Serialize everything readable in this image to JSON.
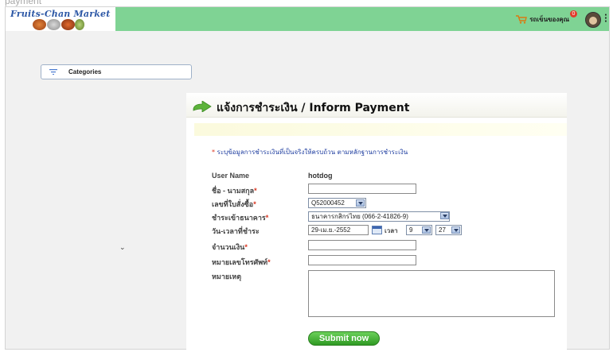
{
  "page": {
    "corner_text": "payment"
  },
  "header": {
    "logo_text": "Fruits-Chan Market",
    "cart_label": "รถเข็นของคุณ",
    "cart_count": "0",
    "colors": {
      "topbar": "#7fd394",
      "logo_text": "#2d58a6"
    }
  },
  "sidebar": {
    "categories_label": "Categories",
    "icon": "menu-lines-icon"
  },
  "form": {
    "title": "แจ้งการชำระเงิน / Inform Payment",
    "instruction_star": "*",
    "instruction": " ระบุข้อมูลการชำระเงินที่เป็นจริงให้ครบถ้วน ตามหลักฐานการชำระเงิน",
    "username_label": "User Name",
    "username_value": "hotdog",
    "fullname_label": "ชื่อ - นามสกุล",
    "order_label": "เลขที่ใบสั่งซื้อ",
    "order_value": "Q52000452",
    "bank_label": "ชำระเข้าธนาคาร",
    "bank_value": "ธนาคารกสิกรไทย (066-2-41826-9)",
    "datetime_label": "วัน-เวลาที่ชำระ",
    "date_value": "29-เม.ย.-2552",
    "time_label": "เวลา",
    "hour_value": "9",
    "minute_value": "27",
    "amount_label": "จำนวนเงิน",
    "phone_label": "หมายเลขโทรศัพท์",
    "note_label": "หมายเหตุ",
    "required_mark": "*",
    "submit_label": "Submit now",
    "colors": {
      "instruction": "#1f3ea0",
      "required": "#d9341f",
      "submit": "#3fae30"
    }
  }
}
